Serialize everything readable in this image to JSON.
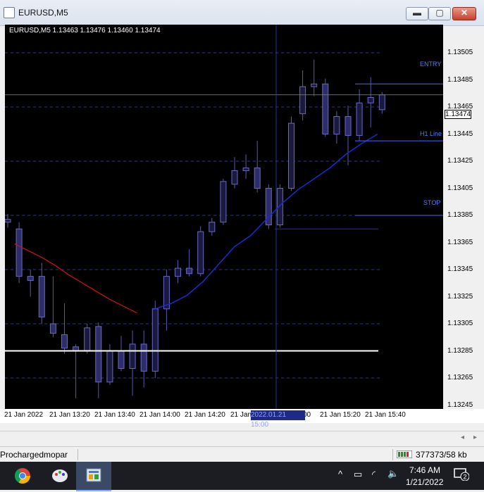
{
  "window": {
    "title": "EURUSD,M5",
    "min_label": "▬",
    "max_label": "▢",
    "close_label": "✕"
  },
  "chart": {
    "header": "EURUSD,M5  1.13463 1.13476 1.13460 1.13474",
    "current_price": "1.13474",
    "price_ticks": [
      "1.13505",
      "1.13485",
      "1.13465",
      "1.13445",
      "1.13425",
      "1.13405",
      "1.13385",
      "1.13365",
      "1.13345",
      "1.13325",
      "1.13305",
      "1.13285",
      "1.13265",
      "1.13245"
    ],
    "time_ticks": [
      "21 Jan 2022",
      "21 Jan 13:20",
      "21 Jan 13:40",
      "21 Jan 14:00",
      "21 Jan 14:20",
      "21 Jan",
      "00",
      "21 Jan 15:20",
      "21 Jan 15:40"
    ],
    "time_cursor": "2022.01.21 15:00",
    "lines": {
      "entry": "ENTRY",
      "h1": "H1 Line",
      "stop": "STOP"
    },
    "colors": {
      "background": "#000000",
      "candle": "#2e2d6b",
      "ma_fast": "#d41010",
      "ma_slow": "#1b2bd0",
      "level_line": "#4a63ff"
    }
  },
  "chart_data": {
    "type": "candlestick",
    "ylim": [
      1.13245,
      1.13515
    ],
    "candles": [
      {
        "o": 1.1338,
        "h": 1.13386,
        "l": 1.13376,
        "c": 1.13382
      },
      {
        "o": 1.13375,
        "h": 1.1338,
        "l": 1.13335,
        "c": 1.1334
      },
      {
        "o": 1.1334,
        "h": 1.13345,
        "l": 1.13325,
        "c": 1.13337
      },
      {
        "o": 1.1334,
        "h": 1.1335,
        "l": 1.13305,
        "c": 1.1331
      },
      {
        "o": 1.13305,
        "h": 1.1334,
        "l": 1.13295,
        "c": 1.13298
      },
      {
        "o": 1.13297,
        "h": 1.1332,
        "l": 1.13283,
        "c": 1.13287
      },
      {
        "o": 1.13288,
        "h": 1.1329,
        "l": 1.1325,
        "c": 1.13285
      },
      {
        "o": 1.13285,
        "h": 1.13305,
        "l": 1.13283,
        "c": 1.13302
      },
      {
        "o": 1.13303,
        "h": 1.13306,
        "l": 1.1325,
        "c": 1.13262
      },
      {
        "o": 1.13262,
        "h": 1.1329,
        "l": 1.1326,
        "c": 1.13285
      },
      {
        "o": 1.13285,
        "h": 1.13296,
        "l": 1.1327,
        "c": 1.13272
      },
      {
        "o": 1.13272,
        "h": 1.133,
        "l": 1.13252,
        "c": 1.1329
      },
      {
        "o": 1.1329,
        "h": 1.133,
        "l": 1.13258,
        "c": 1.1327
      },
      {
        "o": 1.1327,
        "h": 1.13322,
        "l": 1.13265,
        "c": 1.13316
      },
      {
        "o": 1.13316,
        "h": 1.13345,
        "l": 1.133,
        "c": 1.1334
      },
      {
        "o": 1.1334,
        "h": 1.13352,
        "l": 1.13335,
        "c": 1.13346
      },
      {
        "o": 1.13346,
        "h": 1.1336,
        "l": 1.1334,
        "c": 1.13342
      },
      {
        "o": 1.13342,
        "h": 1.13377,
        "l": 1.1334,
        "c": 1.13373
      },
      {
        "o": 1.13373,
        "h": 1.13383,
        "l": 1.1337,
        "c": 1.1338
      },
      {
        "o": 1.1338,
        "h": 1.13412,
        "l": 1.13378,
        "c": 1.1341
      },
      {
        "o": 1.13408,
        "h": 1.13428,
        "l": 1.13405,
        "c": 1.13418
      },
      {
        "o": 1.13418,
        "h": 1.1343,
        "l": 1.13412,
        "c": 1.1342
      },
      {
        "o": 1.1342,
        "h": 1.1344,
        "l": 1.13402,
        "c": 1.13405
      },
      {
        "o": 1.13405,
        "h": 1.13408,
        "l": 1.13375,
        "c": 1.13378
      },
      {
        "o": 1.13378,
        "h": 1.13408,
        "l": 1.13376,
        "c": 1.13405
      },
      {
        "o": 1.13405,
        "h": 1.13458,
        "l": 1.13403,
        "c": 1.13453
      },
      {
        "o": 1.1346,
        "h": 1.13492,
        "l": 1.13455,
        "c": 1.1348
      },
      {
        "o": 1.1348,
        "h": 1.135,
        "l": 1.13473,
        "c": 1.13482
      },
      {
        "o": 1.13482,
        "h": 1.13486,
        "l": 1.13443,
        "c": 1.13445
      },
      {
        "o": 1.13445,
        "h": 1.13462,
        "l": 1.13438,
        "c": 1.13458
      },
      {
        "o": 1.13458,
        "h": 1.13466,
        "l": 1.13422,
        "c": 1.13444
      },
      {
        "o": 1.13444,
        "h": 1.13478,
        "l": 1.1344,
        "c": 1.13468
      },
      {
        "o": 1.13468,
        "h": 1.13487,
        "l": 1.1345,
        "c": 1.13472
      },
      {
        "o": 1.13463,
        "h": 1.13476,
        "l": 1.1346,
        "c": 1.13474
      }
    ],
    "ma_fast": [
      1.13364,
      1.13359,
      1.13354,
      1.13348,
      1.13341,
      1.13335,
      1.13329,
      1.13323,
      1.13318,
      1.13313
    ],
    "ma_slow": [
      1.13316,
      1.1332,
      1.13326,
      1.13336,
      1.13349,
      1.13362,
      1.1337,
      1.13382,
      1.13394,
      1.13404,
      1.13412,
      1.1342,
      1.1343,
      1.13438,
      1.13445
    ],
    "levels": {
      "entry": 1.13482,
      "h1": 1.1344,
      "stop": 1.13385,
      "support": 1.13285,
      "stop_extension": 1.13375
    },
    "grid": true
  },
  "scroll": {
    "left": "◂",
    "right": "▸"
  },
  "status": {
    "profile": "Prochargedmopar",
    "traffic": "377373/58 kb"
  },
  "taskbar": {
    "tray": {
      "chevron": "^",
      "battery": "▭",
      "wifi": "◜",
      "volume": "🔈"
    },
    "time": "7:46 AM",
    "date": "1/21/2022",
    "notifications": "2"
  }
}
